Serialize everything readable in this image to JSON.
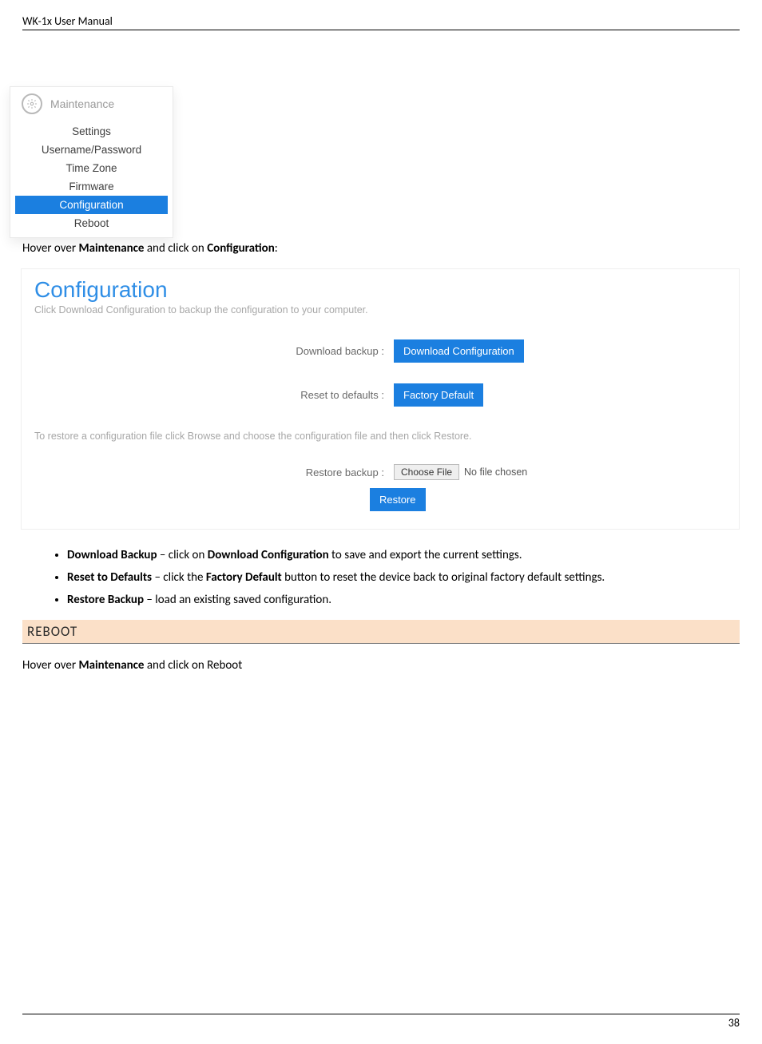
{
  "header": {
    "title": "WK-1x User Manual"
  },
  "menu": {
    "top_label": "Maintenance",
    "items": [
      "Settings",
      "Username/Password",
      "Time Zone",
      "Firmware",
      "Configuration",
      "Reboot"
    ],
    "active_index": 4
  },
  "instruction1_pre": "Hover over ",
  "instruction1_b1": "Maintenance",
  "instruction1_mid": " and click on ",
  "instruction1_b2": "Configuration",
  "instruction1_post": ":",
  "config_panel": {
    "title": "Configuration",
    "subtext": "Click Download Configuration to backup the configuration to your computer.",
    "row1_label": "Download backup :",
    "row1_btn": "Download Configuration",
    "row2_label": "Reset to defaults :",
    "row2_btn": "Factory Default",
    "note2": "To restore a configuration file click Browse and choose the configuration file and then click Restore.",
    "row3_label": "Restore backup :",
    "row3_btn": "Choose File",
    "row3_filetext": "No file chosen",
    "restore_btn": "Restore"
  },
  "bullets": {
    "b1_strong": "Download Backup",
    "b1_mid": " – click on ",
    "b1_strong2": "Download Configuration",
    "b1_tail": " to save and export the current settings.",
    "b2_strong": "Reset to Defaults",
    "b2_mid": " – click the ",
    "b2_strong2": "Factory Default",
    "b2_tail": " button to reset the device back to original factory default settings.",
    "b3_strong": "Restore Backup",
    "b3_tail": " – load an existing saved configuration."
  },
  "section_heading": "REBOOT",
  "instruction2_pre": "Hover over ",
  "instruction2_b1": "Maintenance",
  "instruction2_post": " and click on Reboot",
  "footer": {
    "page": "38"
  }
}
